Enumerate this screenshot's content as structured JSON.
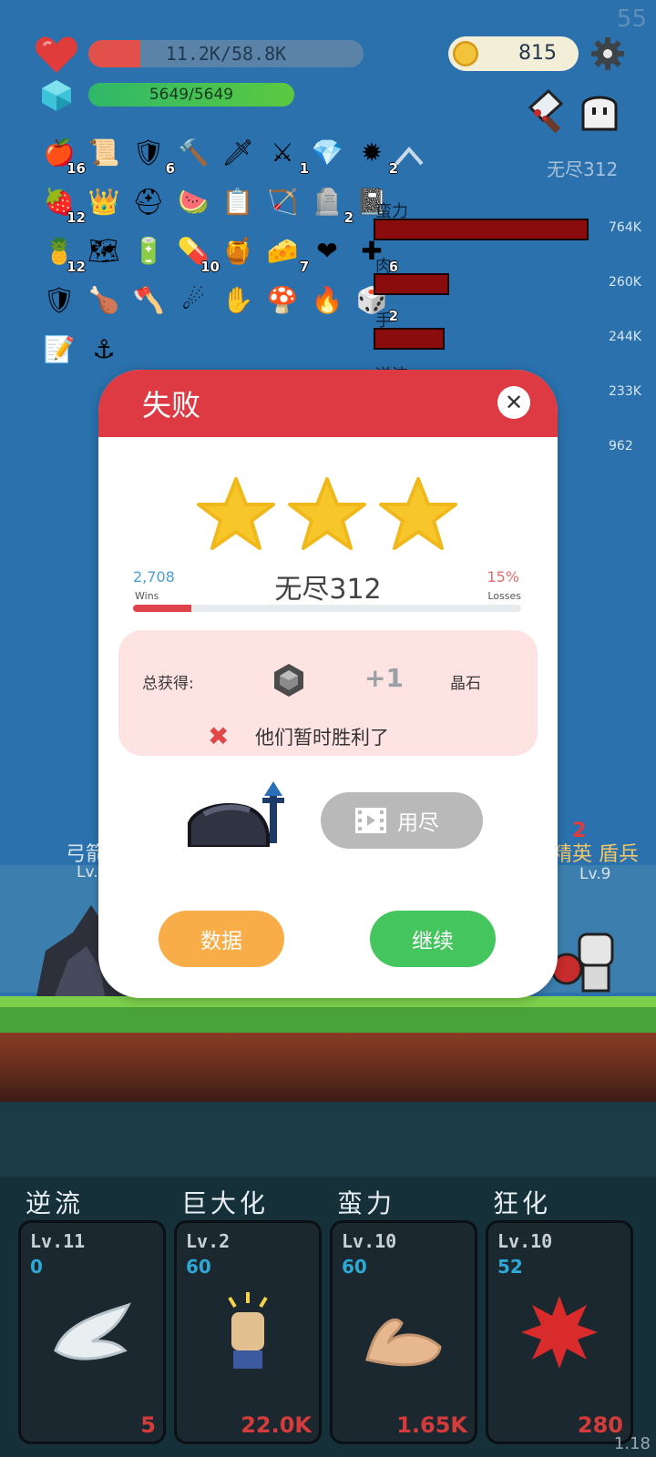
{
  "hud": {
    "fps": "55",
    "hp_text": "11.2K/58.8K",
    "hp_fraction": 0.19,
    "mp_text": "5649/5649",
    "mp_fraction": 1.0,
    "coins": "815",
    "stage": "无尽312"
  },
  "inventory": {
    "items": [
      {
        "icon": "apple-icon",
        "count": "16"
      },
      {
        "icon": "scroll-icon",
        "count": ""
      },
      {
        "icon": "shield-round-icon",
        "count": "6"
      },
      {
        "icon": "mace-icon",
        "count": ""
      },
      {
        "icon": "sword-icon",
        "count": ""
      },
      {
        "icon": "long-sword-icon",
        "count": "1"
      },
      {
        "icon": "ruby-icon",
        "count": ""
      },
      {
        "icon": "spiked-mace-icon",
        "count": "2"
      },
      {
        "icon": "strawberry-icon",
        "count": "12"
      },
      {
        "icon": "crown-icon",
        "count": ""
      },
      {
        "icon": "helmet-icon",
        "count": ""
      },
      {
        "icon": "watermelon-icon",
        "count": ""
      },
      {
        "icon": "checklist-icon",
        "count": ""
      },
      {
        "icon": "crossbow-icon",
        "count": ""
      },
      {
        "icon": "tombstone-icon",
        "count": "2"
      },
      {
        "icon": "skull-book-icon",
        "count": ""
      },
      {
        "icon": "golden-fruit-icon",
        "count": "12"
      },
      {
        "icon": "treasure-map-icon",
        "count": ""
      },
      {
        "icon": "battery-icon",
        "count": ""
      },
      {
        "icon": "pill-icon",
        "count": "10"
      },
      {
        "icon": "jam-jar-icon",
        "count": ""
      },
      {
        "icon": "cheese-icon",
        "count": "7"
      },
      {
        "icon": "heart-icon",
        "count": ""
      },
      {
        "icon": "dpad-icon",
        "count": "6"
      },
      {
        "icon": "crest-shield-icon",
        "count": ""
      },
      {
        "icon": "drumstick-icon",
        "count": ""
      },
      {
        "icon": "battle-axe-icon",
        "count": ""
      },
      {
        "icon": "meteor-icon",
        "count": ""
      },
      {
        "icon": "hand-icon",
        "count": ""
      },
      {
        "icon": "mushroom-icon",
        "count": ""
      },
      {
        "icon": "flame-icon",
        "count": ""
      },
      {
        "icon": "dice-icon",
        "count": "2"
      },
      {
        "icon": "quill-paper-icon",
        "count": ""
      },
      {
        "icon": "hook-icon",
        "count": ""
      }
    ]
  },
  "damage_stats": [
    {
      "name": "蛮力",
      "value": "764K",
      "fraction": 1.0
    },
    {
      "name": "肉",
      "value": "260K",
      "fraction": 0.34
    },
    {
      "name": "手",
      "value": "244K",
      "fraction": 0.32
    },
    {
      "name": "逆流",
      "value": "233K",
      "fraction": 0.3
    },
    {
      "name": "",
      "value": "962",
      "fraction": 0.0
    }
  ],
  "scene": {
    "left_unit_name": "弓箭",
    "left_unit_level": "Lv.",
    "right_unit_names": "精英 盾兵",
    "right_unit_level": "Lv.9",
    "damage_number": "2"
  },
  "dialog": {
    "title": "失败",
    "stars": 3,
    "wins_value": "2,708",
    "wins_label": "Wins",
    "losses_value": "15%",
    "losses_label": "Losses",
    "stage": "无尽312",
    "progress_fraction": 0.15,
    "reward_label": "总获得:",
    "reward_amount": "+1",
    "reward_item": "晶石",
    "fail_message": "他们暂时胜利了",
    "video_button": "用尽",
    "data_button": "数据",
    "continue_button": "继续"
  },
  "skills": [
    {
      "title": "逆流",
      "level": "Lv.11",
      "count": "0",
      "cost": "5",
      "icon": "wing-icon"
    },
    {
      "title": "巨大化",
      "level": "Lv.2",
      "count": "60",
      "cost": "22.0K",
      "icon": "fist-icon"
    },
    {
      "title": "蛮力",
      "level": "Lv.10",
      "count": "60",
      "cost": "1.65K",
      "icon": "flexed-arm-icon"
    },
    {
      "title": "狂化",
      "level": "Lv.10",
      "count": "52",
      "cost": "280",
      "icon": "rage-burst-icon"
    }
  ],
  "version": "1.18",
  "colors": {
    "primary": "#de3a43",
    "accent_orange": "#f8ad49",
    "accent_green": "#45c55d",
    "background": "#2a71ad"
  }
}
